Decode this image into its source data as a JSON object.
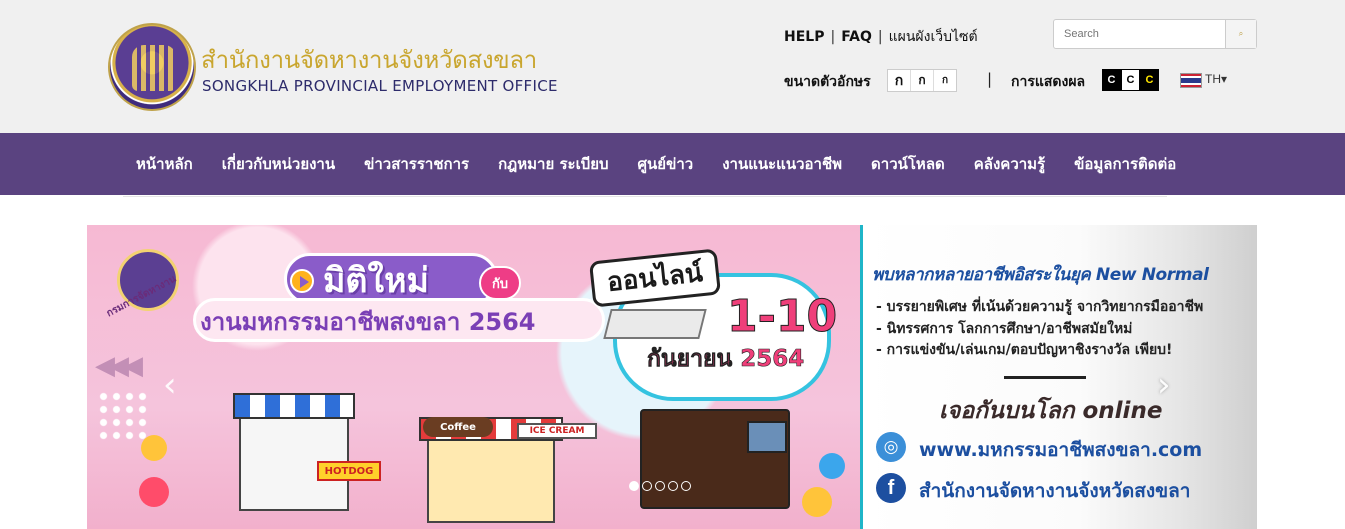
{
  "header": {
    "org_name_th": "สำนักงานจัดหางานจังหวัดสงขลา",
    "org_name_en": "SONGKHLA PROVINCIAL EMPLOYMENT OFFICE",
    "links": {
      "help": "HELP",
      "faq": "FAQ",
      "sitemap": "แผนผังเว็บไซต์",
      "separator": "|"
    },
    "search": {
      "placeholder": "Search",
      "icon": "search-icon"
    },
    "font_size": {
      "label": "ขนาดตัวอักษร",
      "options": [
        "ก",
        "ก",
        "ก"
      ]
    },
    "display_separator": "|",
    "display": {
      "label": "การแสดงผล",
      "options": [
        "C",
        "C",
        "C"
      ]
    },
    "language": {
      "current": "TH",
      "caret": "▾",
      "icon": "thai-flag-icon"
    }
  },
  "nav": {
    "items": [
      "หน้าหลัก",
      "เกี่ยวกับหน่วยงาน",
      "ข่าวสารราชการ",
      "กฎหมาย ระเบียบ",
      "ศูนย์ข่าว",
      "งานแนะแนวอาชีพ",
      "ดาวน์โหลด",
      "คลังความรู้",
      "ข้อมูลการติดต่อ"
    ]
  },
  "banner": {
    "dept_label": "กรมการจัดหางาน",
    "headline_1": "มิติใหม่",
    "headline_with": "กับ",
    "headline_2": "งานมหกรรมอาชีพสงขลา 2564",
    "online_label": "ออนไลน์",
    "dates": "1-10",
    "month_year": "กันยายน 2564",
    "stall_hotdog": "HOTDOG",
    "stall_coffee": "Coffee",
    "stall_icecream": "ICE CREAM",
    "panel_title": "พบหลากหลายอาชีพอิสระในยุค New Normal",
    "panel_items": [
      "- บรรยายพิเศษ ที่เน้นด้วยความรู้ จากวิทยากรมืออาชีพ",
      "- นิทรรศการ โลกการศึกษา/อาชีพสมัยใหม่",
      "- การแข่งขัน/เล่นเกม/ตอบปัญหาชิงรางวัล เพียบ!"
    ],
    "meet_online": "เจอกันบนโลก online",
    "website": "www.มหกรรมอาชีพสงขลา.com",
    "facebook": "สำนักงานจัดหางานจังหวัดสงขลา",
    "carousel": {
      "prev": "‹",
      "next": "›",
      "slide_count": 5,
      "active_index": 0
    }
  },
  "colors": {
    "nav_bg": "#5a4380",
    "title_gold": "#c9a62f",
    "title_navy": "#2d2b6b",
    "banner_pink": "#f7c8dc"
  }
}
